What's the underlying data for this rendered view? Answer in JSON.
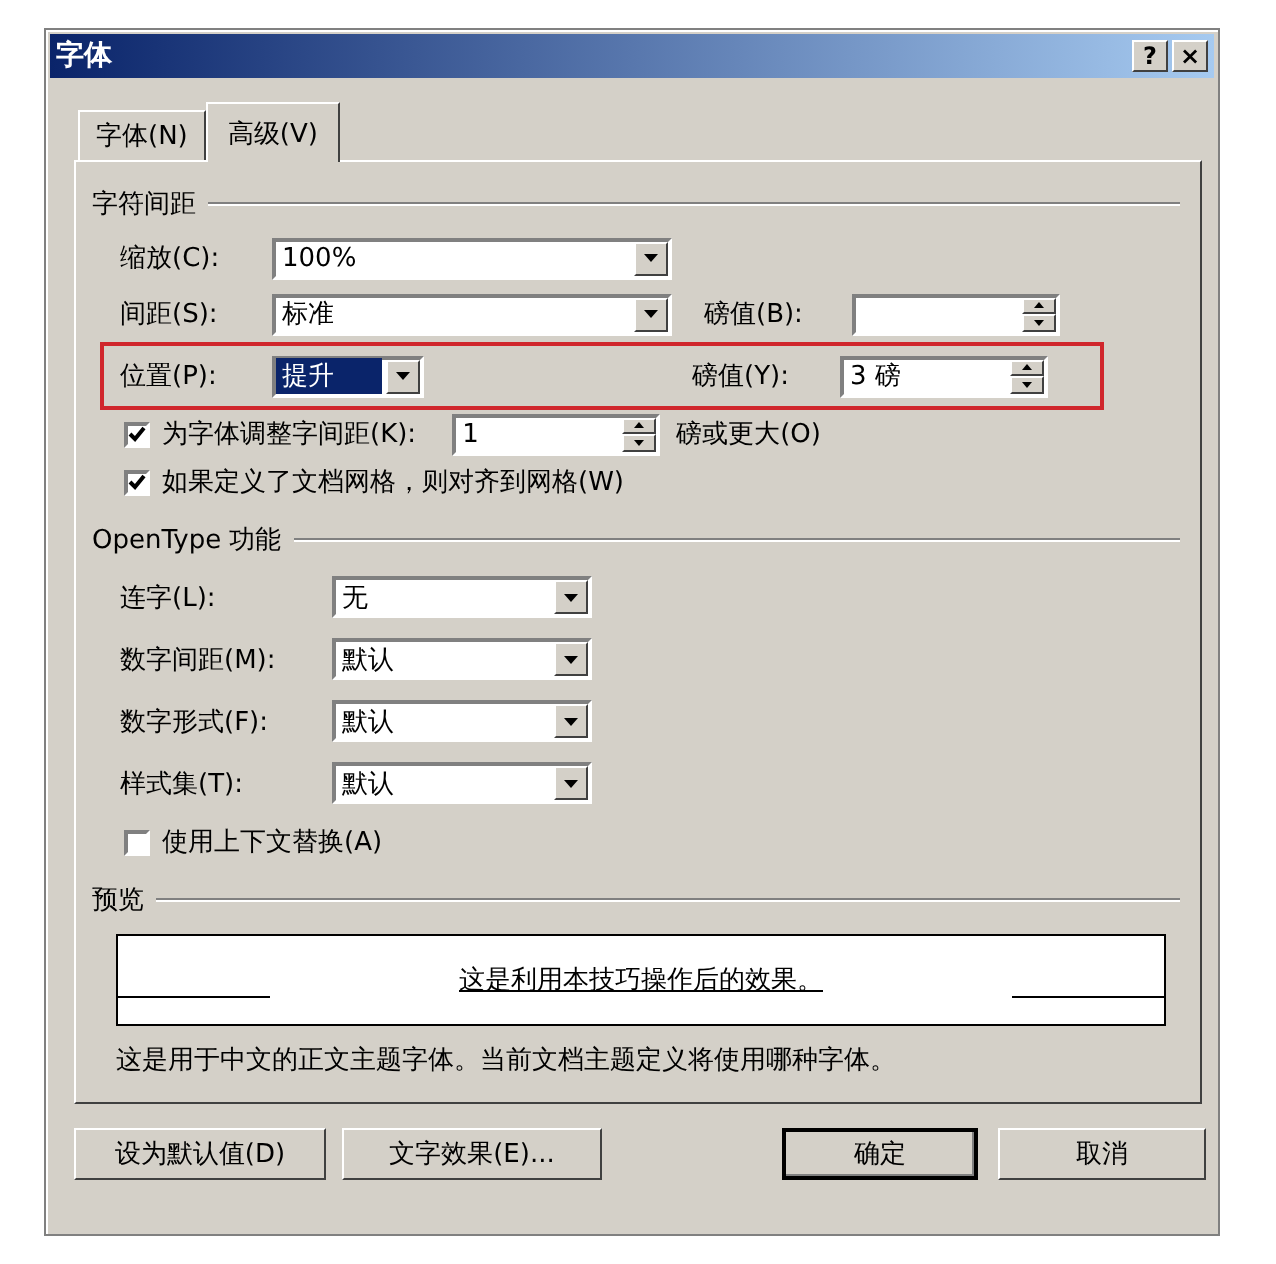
{
  "window": {
    "title": "字体",
    "help_button": "?",
    "close_button": "×"
  },
  "tabs": [
    {
      "label": "字体(N)",
      "selected": false
    },
    {
      "label": "高级(V)",
      "selected": true
    }
  ],
  "spacing_group": {
    "title": "字符间距",
    "scale": {
      "label": "缩放(C):",
      "value": "100%"
    },
    "spacing": {
      "label": "间距(S):",
      "value": "标准",
      "points_label": "磅值(B):"
    },
    "position": {
      "label": "位置(P):",
      "value": "提升",
      "highlighted": true,
      "points_label": "磅值(Y):",
      "points_value": "3 磅"
    },
    "kerning": {
      "label": "为字体调整字间距(K):",
      "checked": true,
      "value": "1",
      "suffix": "磅或更大(O)"
    },
    "snap_to_grid": {
      "label": "如果定义了文档网格，则对齐到网格(W)",
      "checked": true
    }
  },
  "opentype_group": {
    "title": "OpenType 功能",
    "dropdowns": [
      {
        "label": "连字(L):",
        "value": "无"
      },
      {
        "label": "数字间距(M):",
        "value": "默认"
      },
      {
        "label": "数字形式(F):",
        "value": "默认"
      },
      {
        "label": "样式集(T):",
        "value": "默认"
      }
    ],
    "contextual": {
      "label": "使用上下文替换(A)",
      "checked": false
    }
  },
  "preview": {
    "title": "预览",
    "sample": "这是利用本技巧操作后的效果。",
    "description": "这是用于中文的正文主题字体。当前文档主题定义将使用哪种字体。"
  },
  "buttons": [
    {
      "label": "设为默认值(D)",
      "kind": "plain"
    },
    {
      "label": "文字效果(E)...",
      "kind": "plain"
    },
    {
      "label": "确定",
      "kind": "default"
    },
    {
      "label": "取消",
      "kind": "plain"
    }
  ]
}
